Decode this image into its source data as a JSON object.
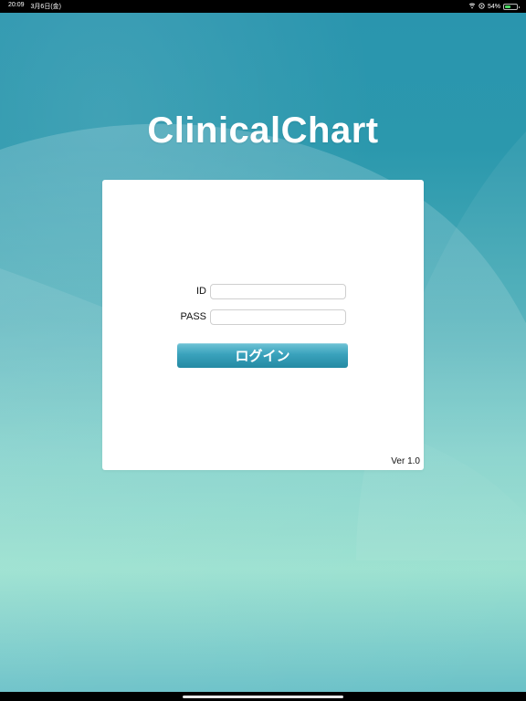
{
  "status_bar": {
    "time": "20:09",
    "date": "3月6日(金)",
    "battery_percent": "54%",
    "battery_level": 0.54,
    "icons": [
      "wifi-icon",
      "location-icon",
      "battery-icon"
    ]
  },
  "app": {
    "title": "ClinicalChart"
  },
  "login": {
    "id_label": "ID",
    "id_value": "",
    "pass_label": "PASS",
    "pass_value": "",
    "button_label": "ログイン",
    "version": "Ver 1.0"
  },
  "colors": {
    "background_top": "#2a95ae",
    "background_bottom": "#95dfcd",
    "button": "#3aa2bc",
    "card": "#ffffff"
  }
}
